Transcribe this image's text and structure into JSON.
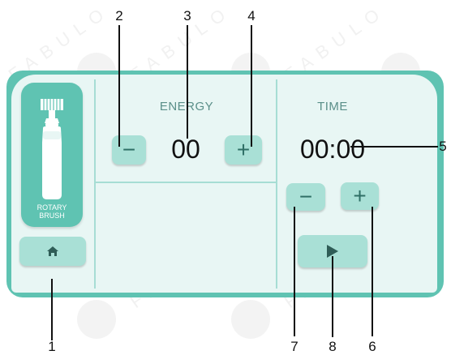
{
  "callouts": {
    "c1": "1",
    "c2": "2",
    "c3": "3",
    "c4": "4",
    "c5": "5",
    "c6": "6",
    "c7": "7",
    "c8": "8"
  },
  "watermark": "FABULO",
  "sidebar": {
    "brush_label_line1": "ROTARY",
    "brush_label_line2": "BRUSH",
    "home_icon": "home-icon"
  },
  "energy": {
    "title": "ENERGY",
    "value": "00",
    "minus_label": "−",
    "plus_label": "+"
  },
  "time": {
    "title": "TIME",
    "value": "00:00",
    "minus_label": "−",
    "plus_label": "+",
    "play_icon": "play-icon"
  },
  "colors": {
    "frame": "#5fc3b2",
    "screen": "#e8f6f4",
    "button": "#a9e0d6"
  }
}
